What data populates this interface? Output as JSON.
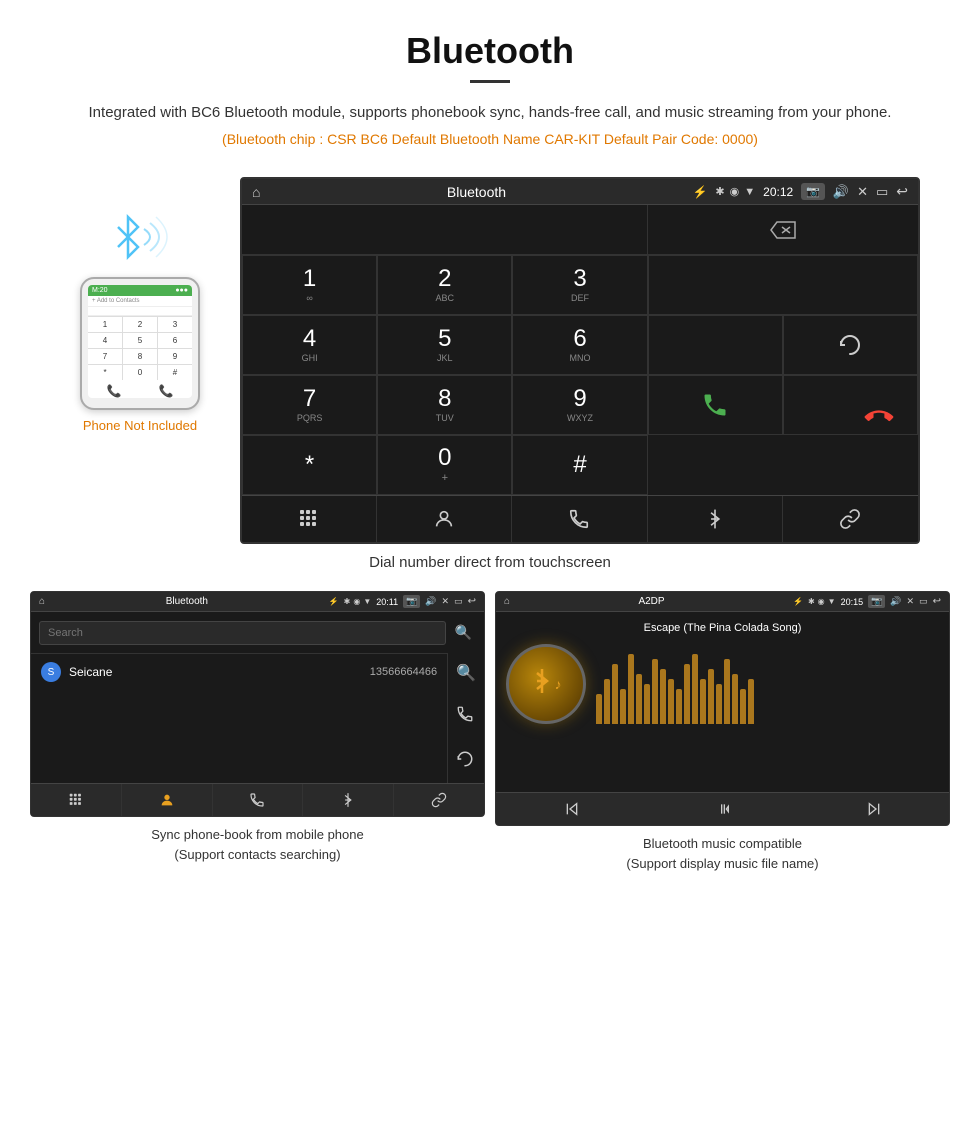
{
  "header": {
    "title": "Bluetooth",
    "description": "Integrated with BC6 Bluetooth module, supports phonebook sync, hands-free call, and music streaming from your phone.",
    "specs": "(Bluetooth chip : CSR BC6   Default Bluetooth Name CAR-KIT    Default Pair Code: 0000)"
  },
  "phone_illustration": {
    "not_included_label": "Phone Not Included"
  },
  "dial_screen": {
    "title": "Bluetooth",
    "time": "20:12",
    "keys": [
      {
        "num": "1",
        "letters": "∞"
      },
      {
        "num": "2",
        "letters": "ABC"
      },
      {
        "num": "3",
        "letters": "DEF"
      },
      {
        "num": "4",
        "letters": "GHI"
      },
      {
        "num": "5",
        "letters": "JKL"
      },
      {
        "num": "6",
        "letters": "MNO"
      },
      {
        "num": "7",
        "letters": "PQRS"
      },
      {
        "num": "8",
        "letters": "TUV"
      },
      {
        "num": "9",
        "letters": "WXYZ"
      },
      {
        "num": "*",
        "letters": ""
      },
      {
        "num": "0",
        "letters": "+"
      },
      {
        "num": "#",
        "letters": ""
      }
    ],
    "caption": "Dial number direct from touchscreen"
  },
  "phonebook_screen": {
    "title": "Bluetooth",
    "time": "20:11",
    "search_placeholder": "Search",
    "contacts": [
      {
        "letter": "S",
        "name": "Seicane",
        "number": "13566664466"
      }
    ],
    "caption_line1": "Sync phone-book from mobile phone",
    "caption_line2": "(Support contacts searching)"
  },
  "music_screen": {
    "title": "A2DP",
    "time": "20:15",
    "song_title": "Escape (The Pina Colada Song)",
    "caption_line1": "Bluetooth music compatible",
    "caption_line2": "(Support display music file name)"
  },
  "bottom_bar": {
    "dialpad_icon": "⊞",
    "contacts_icon": "👤",
    "call_icon": "📞",
    "bluetooth_icon": "✱",
    "link_icon": "🔗"
  },
  "vis_bars": [
    30,
    45,
    60,
    35,
    70,
    50,
    40,
    65,
    55,
    45,
    35,
    60,
    70,
    45,
    55,
    40,
    65,
    50,
    35,
    45
  ]
}
